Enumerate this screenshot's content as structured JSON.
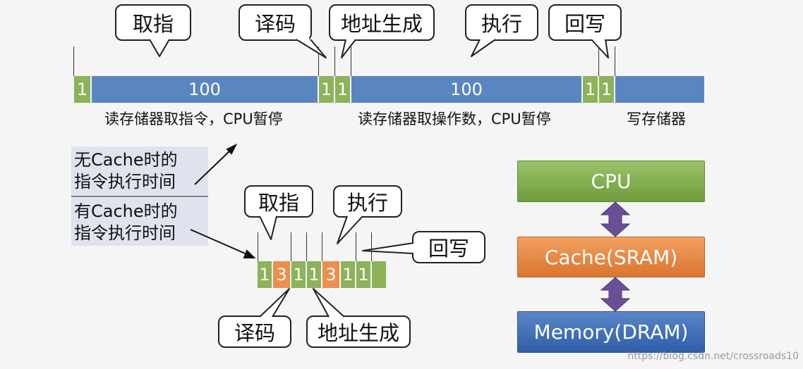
{
  "top_timeline": {
    "segments": [
      {
        "value": "1",
        "color": "green"
      },
      {
        "value": "100",
        "color": "blue"
      },
      {
        "value": "1",
        "color": "green"
      },
      {
        "value": "1",
        "color": "green"
      },
      {
        "value": "100",
        "color": "blue"
      },
      {
        "value": "1",
        "color": "green"
      },
      {
        "value": "1",
        "color": "green"
      },
      {
        "value": "",
        "color": "blue"
      }
    ],
    "callouts": [
      "取指",
      "译码",
      "地址生成",
      "执行",
      "回写"
    ],
    "labels": [
      "读存储器取指令，CPU暂停",
      "读存储器取操作数，CPU暂停",
      "写存储器"
    ]
  },
  "legend": {
    "no_cache": [
      "无Cache时的",
      "指令执行时间"
    ],
    "with_cache": [
      "有Cache时的",
      "指令执行时间"
    ]
  },
  "bottom_timeline": {
    "segments": [
      {
        "value": "1",
        "color": "green"
      },
      {
        "value": "3",
        "color": "orange"
      },
      {
        "value": "1",
        "color": "green"
      },
      {
        "value": "1",
        "color": "green"
      },
      {
        "value": "3",
        "color": "orange"
      },
      {
        "value": "1",
        "color": "green"
      },
      {
        "value": "1",
        "color": "green"
      },
      {
        "value": "",
        "color": "green"
      }
    ],
    "callouts": {
      "fetch": "取指",
      "execute": "执行",
      "writeback": "回写",
      "decode": "译码",
      "address": "地址生成"
    }
  },
  "hierarchy": {
    "cpu": "CPU",
    "cache": "Cache(SRAM)",
    "memory": "Memory(DRAM)"
  },
  "colors": {
    "green": "#8db25a",
    "blue": "#5a86c0",
    "orange": "#ec8f4e",
    "arrow": "#6b4f96"
  },
  "watermark": "https://blog.csdn.net/crossroads10"
}
